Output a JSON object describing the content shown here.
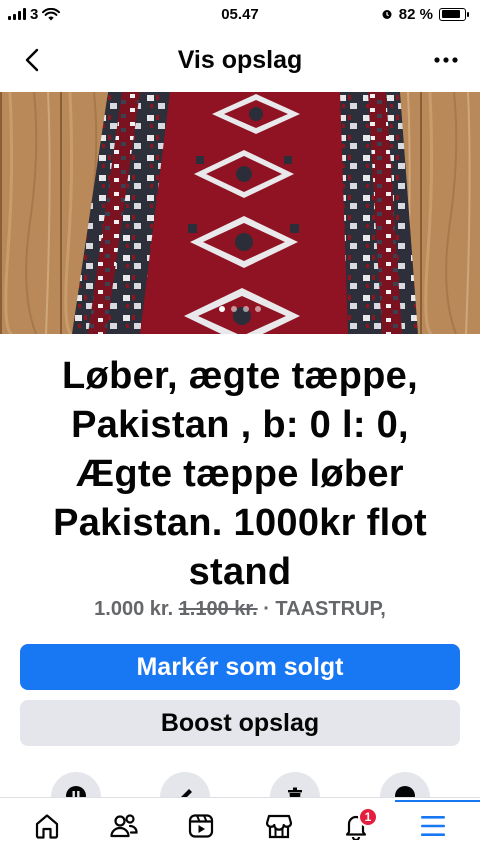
{
  "status_bar": {
    "carrier": "3",
    "time": "05.47",
    "battery_percent": "82 %",
    "battery_level": 0.82
  },
  "nav": {
    "title": "Vis opslag",
    "back_icon": "chevron-left-icon",
    "more_icon": "more-horizontal-icon"
  },
  "photo": {
    "page_count": 4,
    "active_page": 1
  },
  "listing": {
    "title": "Løber, ægte tæppe, Pakistan , b: 0 l: 0, Ægte tæppe løber Pakistan. 1000kr flot stand",
    "price": "1.000 kr.",
    "old_price": "1.100 kr.",
    "location_text": "· TAASTRUP,"
  },
  "buttons": {
    "mark_sold": "Markér som solgt",
    "boost": "Boost opslag"
  },
  "action_icons": [
    "pause-icon",
    "pencil-icon",
    "trash-icon",
    "more-icon"
  ],
  "tabbar": {
    "items": [
      "home-icon",
      "friends-icon",
      "video-icon",
      "marketplace-icon",
      "notifications-icon",
      "menu-icon"
    ],
    "notifications_badge": "1",
    "active": "menu",
    "accent_color": "#1877f2"
  }
}
